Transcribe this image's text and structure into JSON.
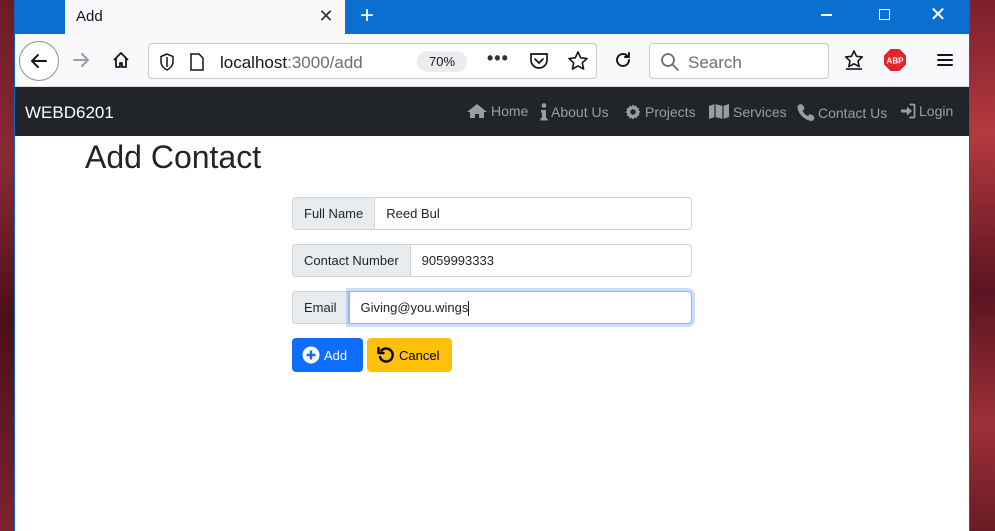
{
  "browser": {
    "tab_title": "Add",
    "url_host": "localhost",
    "url_path": ":3000/add",
    "zoom": "70%",
    "search_placeholder": "Search",
    "abp_label": "ABP"
  },
  "site": {
    "brand": "WEBD6201",
    "nav": [
      {
        "label": "Home",
        "icon": "home-icon"
      },
      {
        "label": "About Us",
        "icon": "info-icon"
      },
      {
        "label": "Projects",
        "icon": "gear-icon"
      },
      {
        "label": "Services",
        "icon": "map-icon"
      },
      {
        "label": "Contact Us",
        "icon": "phone-icon"
      },
      {
        "label": "Login",
        "icon": "sign-in-icon"
      }
    ]
  },
  "page": {
    "title": "Add Contact",
    "fields": [
      {
        "label": "Full Name",
        "value": "Reed Bul"
      },
      {
        "label": "Contact Number",
        "value": "9059993333"
      },
      {
        "label": "Email",
        "value": "Giving@you.wings"
      }
    ],
    "buttons": {
      "add": "Add",
      "cancel": "Cancel"
    }
  },
  "colors": {
    "titlebar": "#0b6fd0",
    "navbar": "#212529",
    "primary": "#0d6efd",
    "warning": "#ffc107"
  }
}
